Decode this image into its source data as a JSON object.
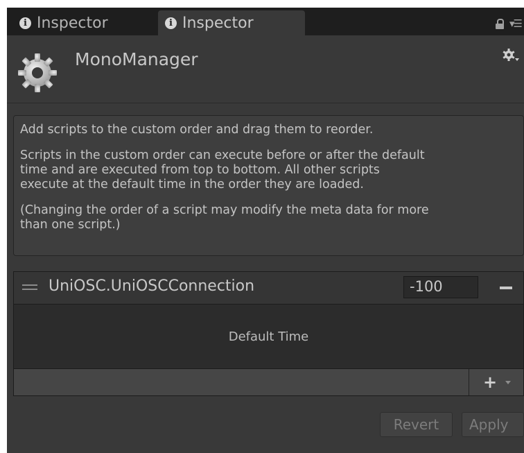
{
  "tabs": [
    {
      "label": "Inspector",
      "icon": "info-icon",
      "active": false
    },
    {
      "label": "Inspector",
      "icon": "info-icon",
      "active": true
    }
  ],
  "tabbar_icons": [
    "lock-icon",
    "menu-icon"
  ],
  "header": {
    "title": "MonoManager",
    "icon": "gear-icon",
    "settings_icon": "settings-gear-icon"
  },
  "help": {
    "paragraphs": [
      "Add scripts to the custom order and drag them to reorder.",
      "Scripts in the custom order can execute before or after the default\ntime and are executed from top to bottom. All other scripts\nexecute at the default time in the order they are loaded.",
      "(Changing the order of a script may modify the meta data for more\nthan one script.)"
    ]
  },
  "script_list": {
    "items": [
      {
        "name": "UniOSC.UniOSCConnection",
        "order": "-100"
      }
    ],
    "default_time_label": "Default Time"
  },
  "buttons": {
    "revert": "Revert",
    "apply": "Apply"
  },
  "colors": {
    "panel_bg": "#393939",
    "tabbar_bg": "#1e1e1e",
    "text": "#c8c8c8",
    "disabled_text": "#7c7c7c"
  }
}
